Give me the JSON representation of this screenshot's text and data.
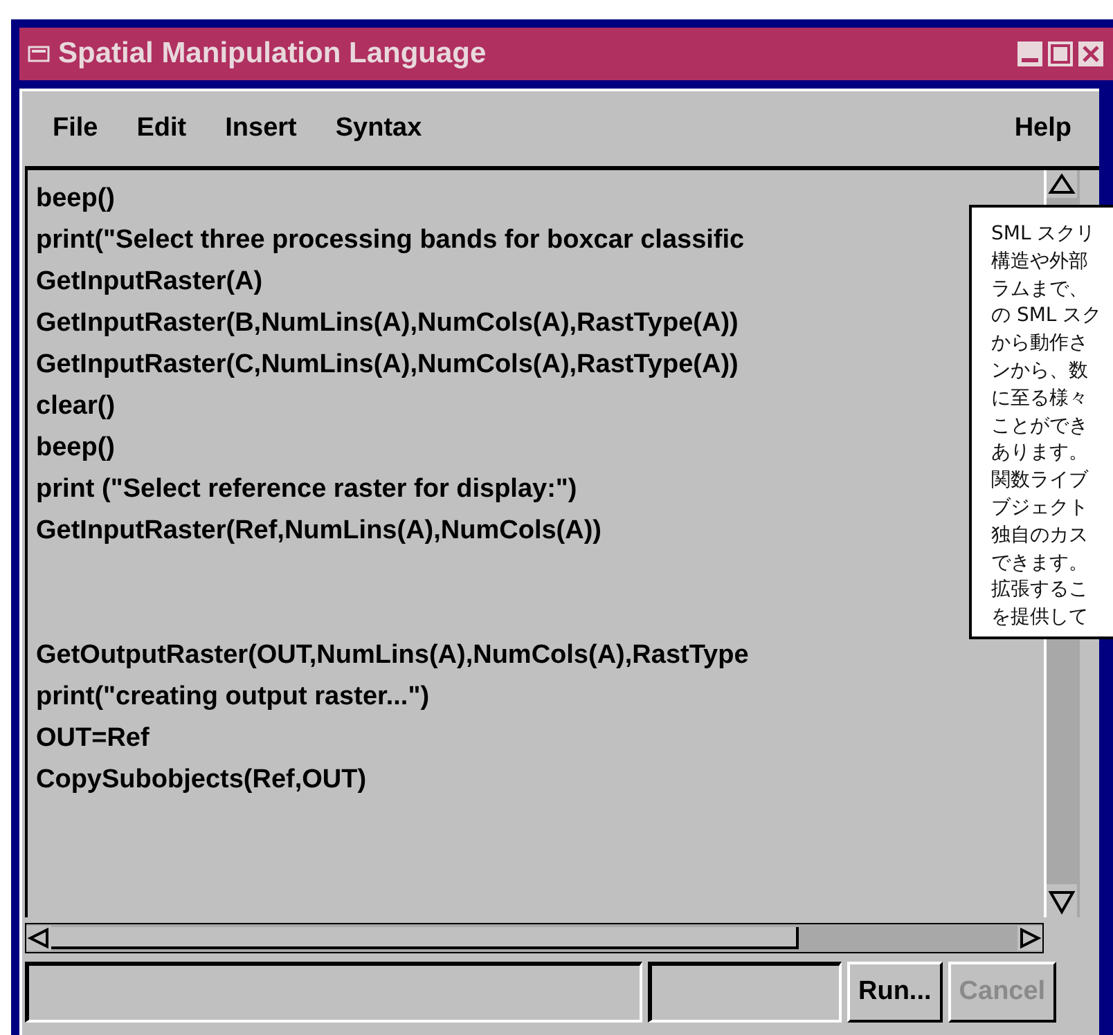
{
  "window": {
    "title": "Spatial Manipulation Language"
  },
  "menu": {
    "left": [
      "File",
      "Edit",
      "Insert",
      "Syntax"
    ],
    "right": [
      "Help"
    ]
  },
  "code_blocks": [
    [
      "beep()",
      "print(\"Select three processing bands for boxcar classific",
      "GetInputRaster(A)",
      "GetInputRaster(B,NumLins(A),NumCols(A),RastType(A))",
      "GetInputRaster(C,NumLins(A),NumCols(A),RastType(A))",
      "clear()",
      "beep()",
      "print (\"Select reference raster for display:\")",
      "GetInputRaster(Ref,NumLins(A),NumCols(A))"
    ],
    [
      "GetOutputRaster(OUT,NumLins(A),NumCols(A),RastType",
      "print(\"creating output raster...\")",
      "OUT=Ref",
      "CopySubobjects(Ref,OUT)"
    ]
  ],
  "buttons": [
    {
      "label": "Run...",
      "disabled": false
    },
    {
      "label": "Cancel",
      "disabled": true
    }
  ],
  "callout": {
    "lines": [
      "SML スクリ",
      "構造や外部",
      "ラムまで、",
      "の SML スク",
      "から動作さ",
      "ンから、数",
      "に至る様々",
      "ことができ",
      "あります。",
      "関数ライブ",
      "ブジェクト",
      "独自のカス",
      "できます。",
      "拡張するこ",
      "を提供して"
    ]
  }
}
